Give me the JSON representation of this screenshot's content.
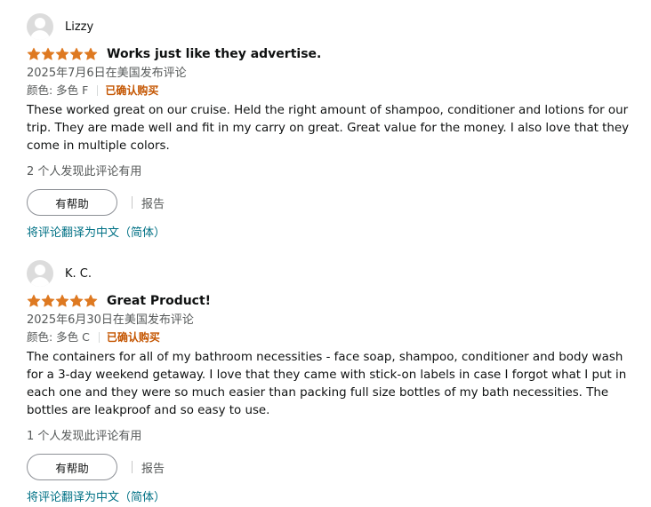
{
  "star_color": "#de7921",
  "reviews": [
    {
      "profile_name": "Lizzy",
      "rating": 5,
      "title": "Works just like they advertise.",
      "date": "2025年7月6日在美国发布评论",
      "variant": "颜色: 多色 F",
      "verified": "已确认购买",
      "body": "These worked great on our cruise. Held the right amount of shampoo, conditioner and lotions for our trip. They are made well and fit in my carry on great. Great value for the money. I also love that they come in multiple colors.",
      "helpful_count": "2 个人发现此评论有用",
      "helpful_button": "有帮助",
      "report": "报告",
      "translate": "将评论翻译为中文（简体）"
    },
    {
      "profile_name": "K. C.",
      "rating": 5,
      "title": "Great Product!",
      "date": "2025年6月30日在美国发布评论",
      "variant": "颜色: 多色 C",
      "verified": "已确认购买",
      "body": "The containers for all of my bathroom necessities - face soap, shampoo, conditioner and body wash for a 3-day weekend getaway. I love that they came with stick-on labels in case I forgot what I put in each one and they were so much easier than packing full size bottles of my bath necessities. The bottles are leakproof and so easy to use.",
      "helpful_count": "1 个人发现此评论有用",
      "helpful_button": "有帮助",
      "report": "报告",
      "translate": "将评论翻译为中文（简体）"
    }
  ]
}
